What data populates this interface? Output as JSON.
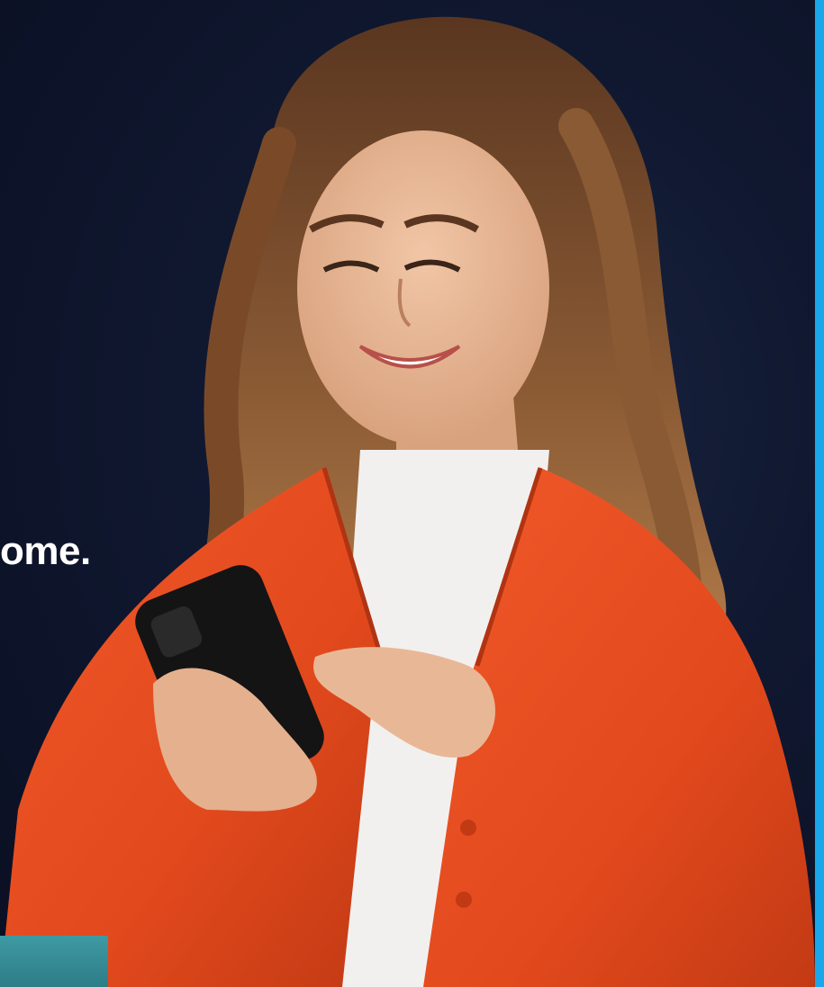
{
  "hero": {
    "headline_fragment": "ome.",
    "photo_subject": "smiling-woman-using-smartphone"
  },
  "colors": {
    "background": "#0b1124",
    "accent_bar": "#19a6ea",
    "teal_band": "#3f9aa3",
    "jacket": "#e2491d",
    "headline_text": "#ffffff"
  }
}
